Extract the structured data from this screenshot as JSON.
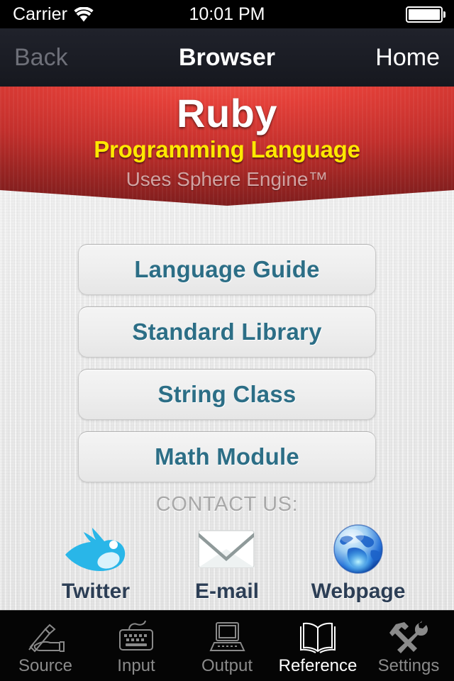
{
  "status_bar": {
    "carrier": "Carrier",
    "wifi_icon": "wifi-icon",
    "time": "10:01 PM",
    "battery_icon": "battery-full-icon"
  },
  "nav_bar": {
    "back_label": "Back",
    "title": "Browser",
    "home_label": "Home"
  },
  "banner": {
    "title": "Ruby",
    "subtitle": "Programming Language",
    "tagline": "Uses Sphere Engine™",
    "title_color": "#ffffff",
    "subtitle_color": "#ffe800",
    "tagline_color": "#d2a3a2",
    "background_color": "#c22f2c"
  },
  "menu": {
    "buttons": [
      {
        "label": "Language Guide"
      },
      {
        "label": "Standard Library"
      },
      {
        "label": "String Class"
      },
      {
        "label": "Math Module"
      }
    ],
    "text_color": "#2c6e86"
  },
  "contact": {
    "heading": "CONTACT US:",
    "items": [
      {
        "label": "Twitter",
        "icon": "twitter-bird-icon"
      },
      {
        "label": "E-mail",
        "icon": "envelope-icon"
      },
      {
        "label": "Webpage",
        "icon": "globe-icon"
      }
    ],
    "label_color": "#2c3e55"
  },
  "tab_bar": {
    "tabs": [
      {
        "label": "Source",
        "icon": "hand-writing-icon",
        "active": false
      },
      {
        "label": "Input",
        "icon": "keyboard-icon",
        "active": false
      },
      {
        "label": "Output",
        "icon": "laptop-icon",
        "active": false
      },
      {
        "label": "Reference",
        "icon": "open-book-icon",
        "active": true
      },
      {
        "label": "Settings",
        "icon": "hammer-wrench-icon",
        "active": false
      }
    ],
    "active_color": "#ffffff",
    "inactive_color": "#8a8a8a"
  }
}
